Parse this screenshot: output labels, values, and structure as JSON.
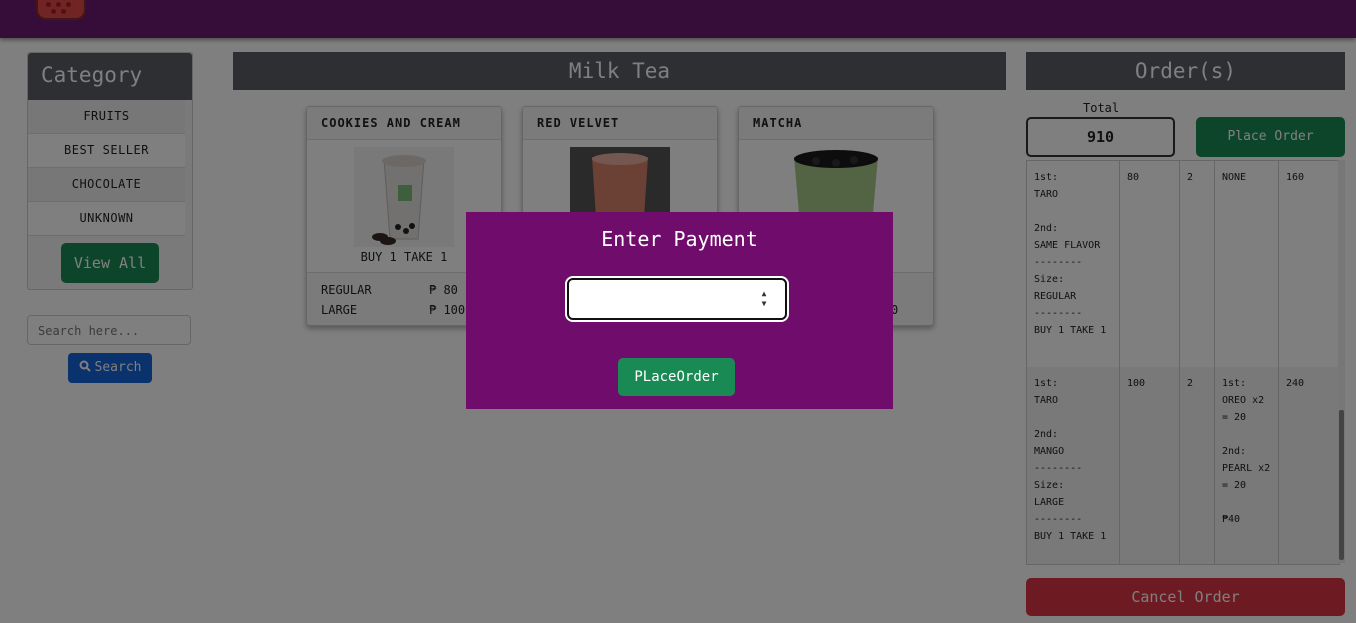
{
  "category": {
    "title": "Category",
    "items": [
      "FRUITS",
      "BEST SELLER",
      "CHOCOLATE",
      "UNKNOWN"
    ],
    "view_all": "View All"
  },
  "search": {
    "placeholder": "Search here...",
    "button": "Search"
  },
  "menu": {
    "title": "Milk Tea",
    "products": [
      {
        "name": "COOKIES AND CREAM",
        "promo": "BUY 1 TAKE 1",
        "sizes": [
          {
            "size": "REGULAR",
            "price": "₱ 80"
          },
          {
            "size": "LARGE",
            "price": "₱ 100"
          }
        ]
      },
      {
        "name": "RED VELVET"
      },
      {
        "name": "MATCHA",
        "price_suffix": "0"
      }
    ]
  },
  "orders": {
    "title": "Order(s)",
    "total_label": "Total",
    "total_value": "910",
    "place_order": "Place Order",
    "cancel_order": "Cancel Order",
    "rows": [
      {
        "details": "1st:\nTARO\n\n2nd:\nSAME FLAVOR\n--------\nSize:\nREGULAR\n--------\nBUY 1 TAKE 1",
        "price": "80",
        "qty": "2",
        "addons": "NONE",
        "subtotal": "160"
      },
      {
        "details": "1st:\nTARO\n\n2nd:\nMANGO\n--------\nSize:\nLARGE\n--------\nBUY 1 TAKE 1",
        "price": "100",
        "qty": "2",
        "addons": "1st:\nOREO x2\n= 20\n\n2nd:\nPEARL x2\n= 20\n\n₱40",
        "subtotal": "240"
      }
    ]
  },
  "modal": {
    "title": "Enter Payment",
    "button": "PLaceOrder"
  },
  "colors": {
    "header": "#6a1a70",
    "modal": "#700d6c",
    "green": "#1a8a55",
    "blue": "#1565d8",
    "red": "#dc3545",
    "panel_head": "#5a5f66"
  }
}
